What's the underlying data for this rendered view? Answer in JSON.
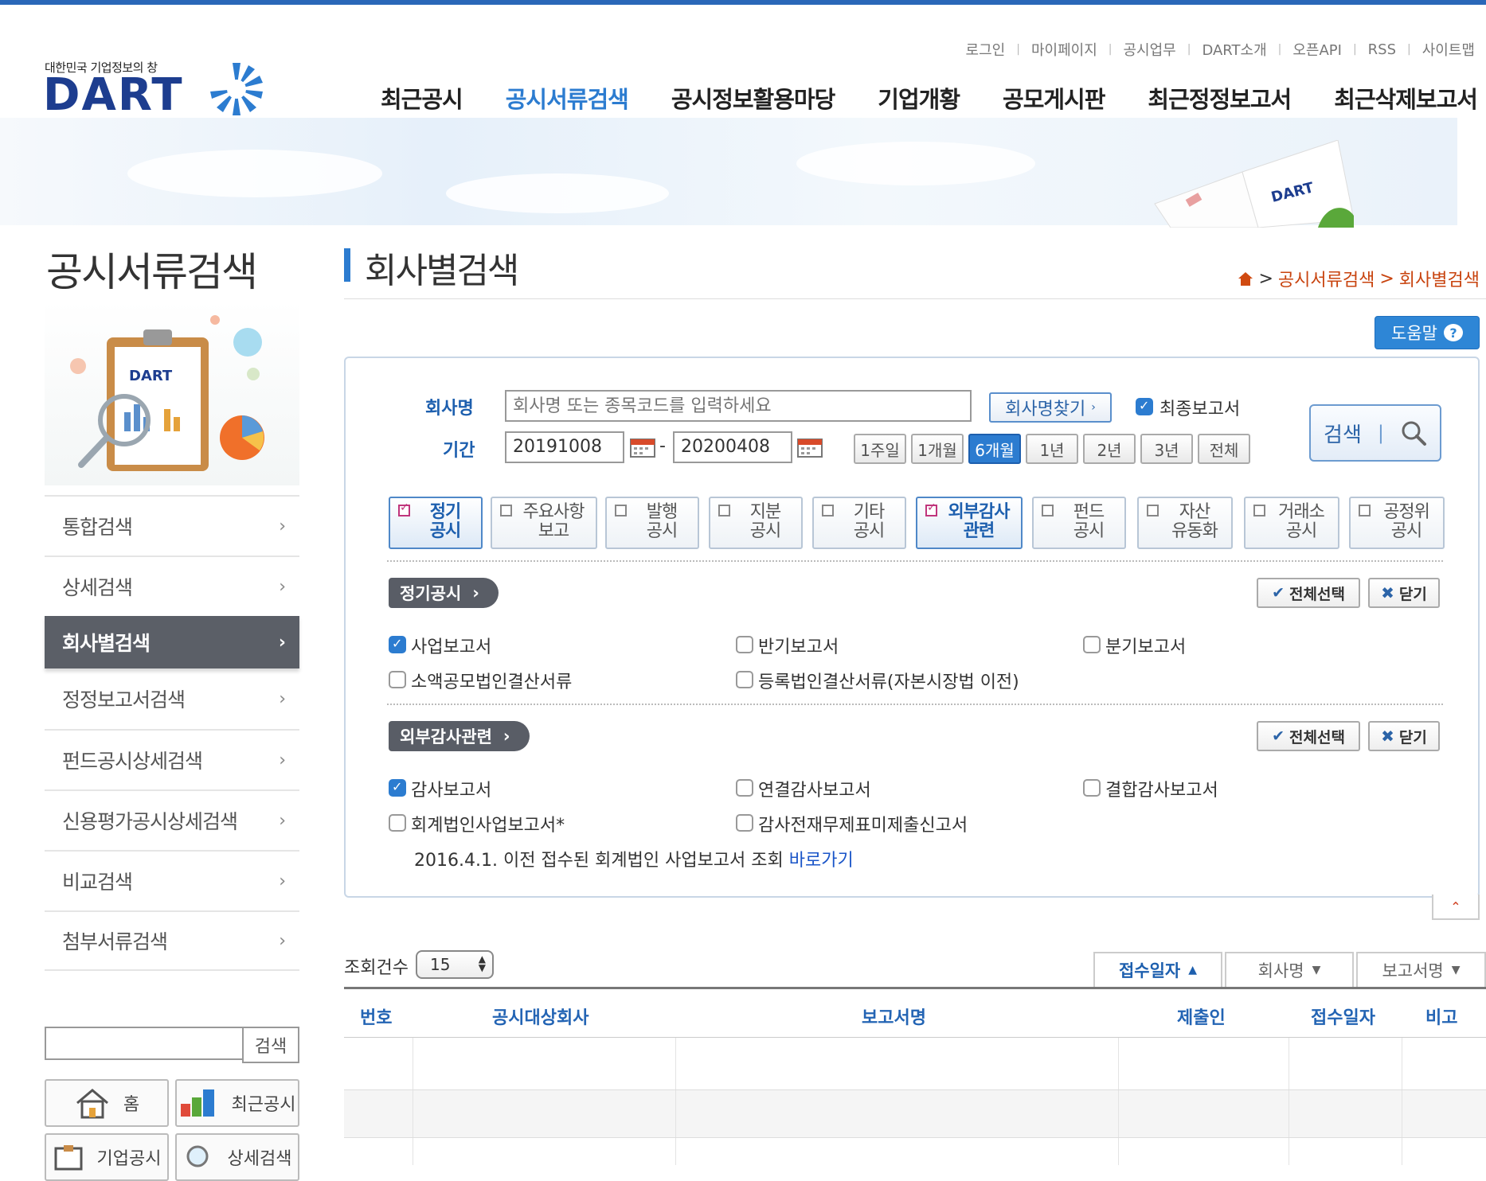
{
  "header": {
    "logo_tagline": "대한민국 기업정보의 창",
    "logo_text": "DART",
    "util_links": [
      "로그인",
      "마이페이지",
      "공시업무",
      "DART소개",
      "오픈API",
      "RSS",
      "사이트맵"
    ],
    "gnb": [
      "최근공시",
      "공시서류검색",
      "공시정보활용마당",
      "기업개황",
      "공모게시판",
      "최근정정보고서",
      "최근삭제보고서"
    ],
    "gnb_active": "공시서류검색",
    "banner_book_label": "DART"
  },
  "sidebar": {
    "title": "공시서류검색",
    "illustration_label": "DART",
    "menu": [
      {
        "label": "통합검색"
      },
      {
        "label": "상세검색"
      },
      {
        "label": "회사별검색",
        "active": true
      },
      {
        "label": "정정보고서검색"
      },
      {
        "label": "펀드공시상세검색"
      },
      {
        "label": "신용평가공시상세검색"
      },
      {
        "label": "비교검색"
      },
      {
        "label": "첨부서류검색"
      }
    ],
    "search_button": "검색",
    "quick_links": [
      "홈",
      "최근공시",
      "기업공시",
      "상세검색"
    ]
  },
  "main": {
    "title": "회사별검색",
    "breadcrumb": [
      "공시서류검색",
      "회사별검색"
    ],
    "help_button": "도움말",
    "form": {
      "company_label": "회사명",
      "company_placeholder": "회사명 또는 종목코드를 입력하세요",
      "find_button": "회사명찾기",
      "final_report_label": "최종보고서",
      "final_report_checked": true,
      "period_label": "기간",
      "date_from": "20191008",
      "date_to": "20200408",
      "date_sep": "-",
      "period_buttons": [
        "1주일",
        "1개월",
        "6개월",
        "1년",
        "2년",
        "3년",
        "전체"
      ],
      "period_active": "6개월",
      "search_button": "검색"
    },
    "categories": [
      {
        "label": "정기\n공시",
        "checked": true
      },
      {
        "label": "주요사항\n보고",
        "checked": false
      },
      {
        "label": "발행\n공시",
        "checked": false
      },
      {
        "label": "지분\n공시",
        "checked": false
      },
      {
        "label": "기타\n공시",
        "checked": false
      },
      {
        "label": "외부감사\n관련",
        "checked": true
      },
      {
        "label": "펀드\n공시",
        "checked": false
      },
      {
        "label": "자산\n유동화",
        "checked": false
      },
      {
        "label": "거래소\n공시",
        "checked": false
      },
      {
        "label": "공정위\n공시",
        "checked": false
      }
    ],
    "sections": [
      {
        "tag": "정기공시",
        "select_all": "전체선택",
        "close": "닫기",
        "items": [
          {
            "label": "사업보고서",
            "checked": true
          },
          {
            "label": "반기보고서",
            "checked": false
          },
          {
            "label": "분기보고서",
            "checked": false
          },
          {
            "label": "소액공모법인결산서류",
            "checked": false
          },
          {
            "label": "등록법인결산서류(자본시장법 이전)",
            "checked": false
          }
        ]
      },
      {
        "tag": "외부감사관련",
        "select_all": "전체선택",
        "close": "닫기",
        "items": [
          {
            "label": "감사보고서",
            "checked": true
          },
          {
            "label": "연결감사보고서",
            "checked": false
          },
          {
            "label": "결합감사보고서",
            "checked": false
          },
          {
            "label": "회계법인사업보고서*",
            "checked": false
          },
          {
            "label": "감사전재무제표미제출신고서",
            "checked": false
          }
        ]
      }
    ],
    "note_text": "2016.4.1. 이전 접수된 회계법인 사업보고서 조회",
    "note_link": "바로가기",
    "results": {
      "count_label": "조회건수",
      "count_value": "15",
      "sort_buttons": [
        {
          "label": "접수일자",
          "dir": "▲",
          "active": true
        },
        {
          "label": "회사명",
          "dir": "▼",
          "active": false
        },
        {
          "label": "보고서명",
          "dir": "▼",
          "active": false
        }
      ],
      "columns": [
        "번호",
        "공시대상회사",
        "보고서명",
        "제출인",
        "접수일자",
        "비고"
      ]
    }
  },
  "colors": {
    "accent": "#2c7cd0",
    "brand": "#1d3d8f",
    "active_menu": "#5b5f67",
    "breadcrumb": "#c8430e"
  }
}
